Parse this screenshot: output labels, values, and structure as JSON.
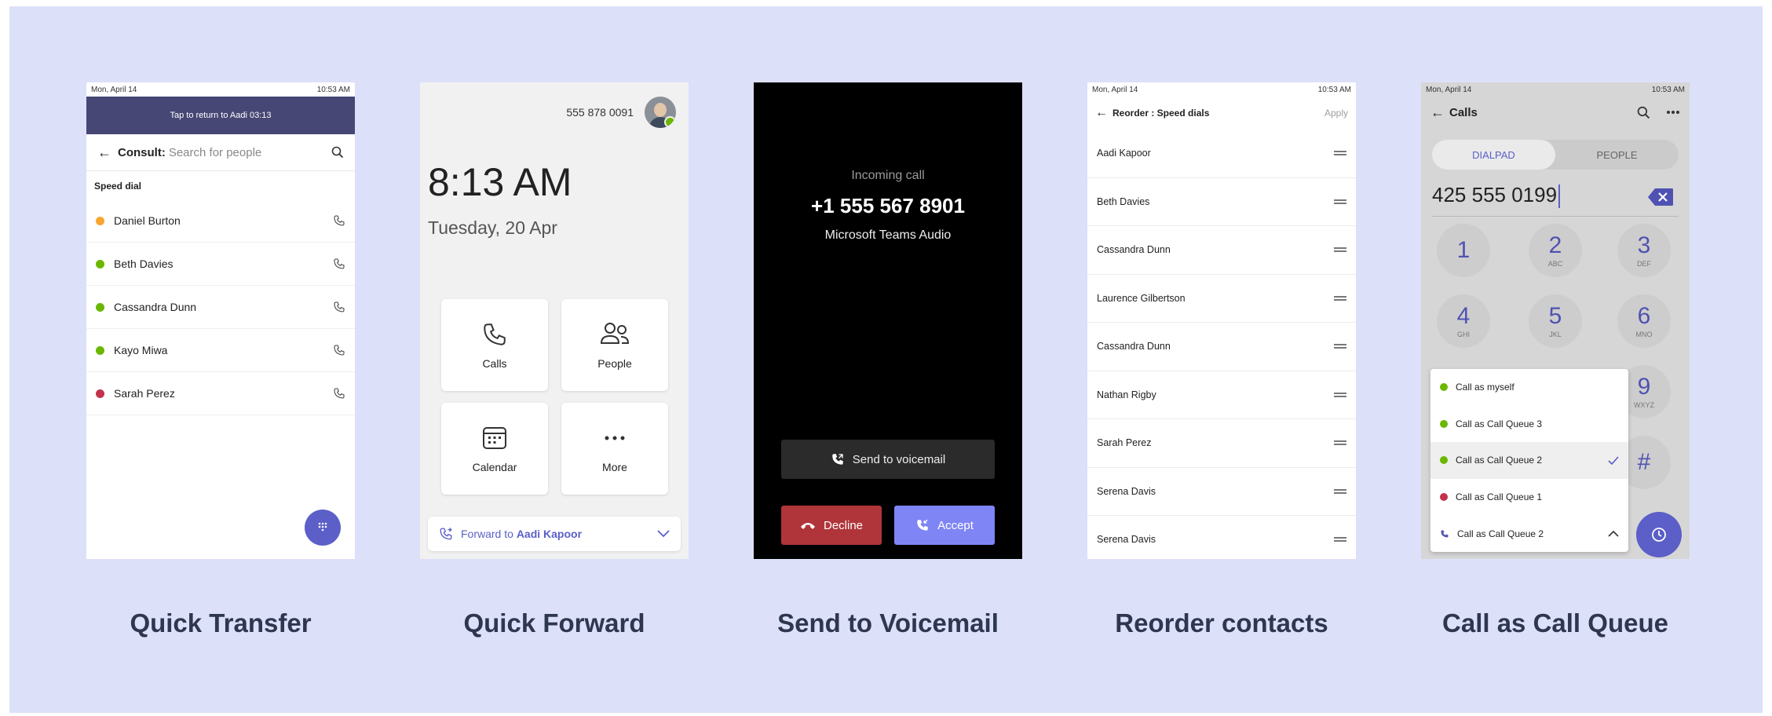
{
  "colors": {
    "background": "#dde0f9",
    "accent": "#5b5fc7",
    "banner": "#464775",
    "available": "#6bb700",
    "away": "#f8a52e",
    "busy": "#c4314b",
    "decline": "#b0353a",
    "accept": "#7f85f5"
  },
  "captions": [
    "Quick Transfer",
    "Quick Forward",
    "Send to Voicemail",
    "Reorder contacts",
    "Call as Call Queue"
  ],
  "quick_transfer": {
    "status_date": "Mon, April 14",
    "status_time": "10:53 AM",
    "banner": "Tap to return to Aadi 03:13",
    "header_label": "Consult:",
    "search_placeholder": "Search for people",
    "section_title": "Speed dial",
    "contacts": [
      {
        "name": "Daniel Burton",
        "presence": "away"
      },
      {
        "name": "Beth Davies",
        "presence": "available"
      },
      {
        "name": "Cassandra Dunn",
        "presence": "available"
      },
      {
        "name": "Kayo Miwa",
        "presence": "available"
      },
      {
        "name": "Sarah Perez",
        "presence": "busy"
      }
    ],
    "icons": {
      "back": "arrow-left-icon",
      "search": "search-icon",
      "call": "phone-icon",
      "fab": "dialpad-icon"
    }
  },
  "quick_forward": {
    "phone_number": "555 878 0091",
    "time": "8:13 AM",
    "date": "Tuesday, 20 Apr",
    "tiles": [
      {
        "label": "Calls",
        "icon": "phone-icon"
      },
      {
        "label": "People",
        "icon": "people-icon"
      },
      {
        "label": "Calendar",
        "icon": "calendar-icon"
      },
      {
        "label": "More",
        "icon": "more-icon"
      }
    ],
    "forward_prefix": "Forward to",
    "forward_target": "Aadi Kapoor"
  },
  "voicemail": {
    "incoming_label": "Incoming call",
    "caller_number": "+1 555 567 8901",
    "source": "Microsoft Teams Audio",
    "voicemail_label": "Send to voicemail",
    "decline_label": "Decline",
    "accept_label": "Accept"
  },
  "reorder": {
    "status_date": "Mon, April 14",
    "status_time": "10:53 AM",
    "title": "Reorder : Speed dials",
    "apply_label": "Apply",
    "contacts": [
      "Aadi Kapoor",
      "Beth Davies",
      "Cassandra Dunn",
      "Laurence Gilbertson",
      "Cassandra Dunn",
      "Nathan Rigby",
      "Sarah Perez",
      "Serena Davis",
      "Serena Davis"
    ]
  },
  "call_queue": {
    "status_date": "Mon, April 14",
    "status_time": "10:53 AM",
    "title": "Calls",
    "tabs": [
      "DIALPAD",
      "PEOPLE"
    ],
    "active_tab": "DIALPAD",
    "dialed_number": "425 555 0199",
    "keys": [
      {
        "digit": "1",
        "letters": ""
      },
      {
        "digit": "2",
        "letters": "ABC"
      },
      {
        "digit": "3",
        "letters": "DEF"
      },
      {
        "digit": "4",
        "letters": "GHI"
      },
      {
        "digit": "5",
        "letters": "JKL"
      },
      {
        "digit": "6",
        "letters": "MNO"
      },
      {
        "digit": "9",
        "letters": "WXYZ"
      },
      {
        "digit": "#",
        "letters": ""
      }
    ],
    "menu": [
      {
        "label": "Call as myself",
        "status": "available"
      },
      {
        "label": "Call as Call Queue 3",
        "status": "available"
      },
      {
        "label": "Call as Call Queue 2",
        "status": "available",
        "selected": true
      },
      {
        "label": "Call as Call Queue 1",
        "status": "busy"
      },
      {
        "label": "Call as Call Queue 2",
        "status": "phone"
      }
    ]
  }
}
